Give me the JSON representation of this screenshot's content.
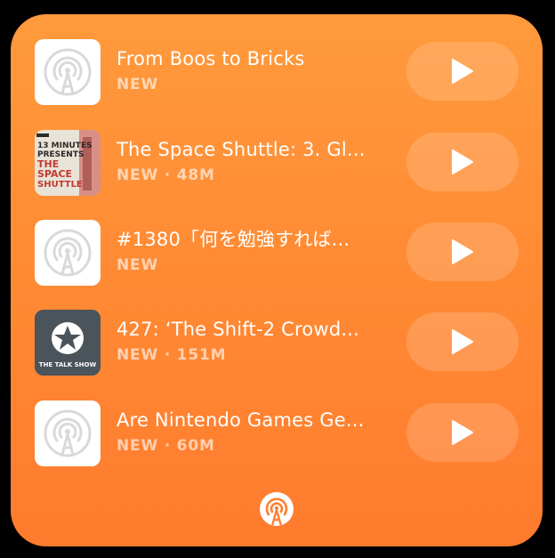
{
  "widget": {
    "episodes": [
      {
        "title": "From Boos to Bricks",
        "meta": "NEW",
        "artwork": "overcast-placeholder-icon"
      },
      {
        "title": "The Space Shuttle: 3. Gl...",
        "meta": "NEW · 48M",
        "artwork": "space-shuttle-artwork"
      },
      {
        "title": "#1380「何を勉強すれば...",
        "meta": "NEW",
        "artwork": "overcast-placeholder-icon"
      },
      {
        "title": "427: ‘The Shift-2 Crowd...",
        "meta": "NEW · 151M",
        "artwork": "talk-show-artwork"
      },
      {
        "title": "Are Nintendo Games Ge...",
        "meta": "NEW · 60M",
        "artwork": "overcast-placeholder-icon"
      }
    ],
    "artwork_text": {
      "shuttle_line1": "13 MINUTES",
      "shuttle_line2": "PRESENTS",
      "shuttle_line3": "THE",
      "shuttle_line4": "SPACE",
      "shuttle_line5": "SHUTTLE",
      "talkshow_name": "THE TALK SHOW"
    },
    "footer_icon": "overcast-logo-icon"
  },
  "colors": {
    "background_top": "#FF9A3C",
    "background_bottom": "#FF7B2E",
    "text_primary": "#FFFFFF",
    "play_button_bg": "rgba(255,255,255,0.16)",
    "placeholder_icon": "#D9D9D9"
  }
}
